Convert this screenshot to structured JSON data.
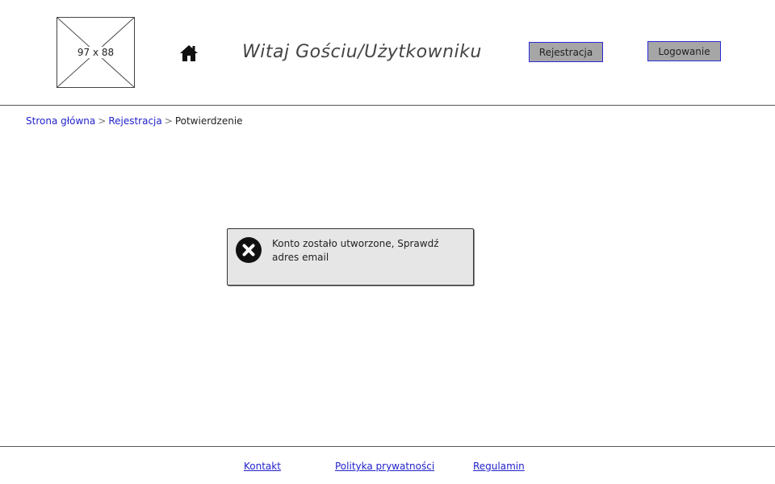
{
  "header": {
    "logo_placeholder_text": "97 x 88",
    "home_icon": "home-icon",
    "welcome_text": "Witaj Gościu/Użytkowniku",
    "register_label": "Rejestracja",
    "login_label": "Logowanie"
  },
  "breadcrumb": {
    "home": "Strona główna",
    "register": "Rejestracja",
    "current": "Potwierdzenie",
    "separator": ">"
  },
  "notification": {
    "icon": "close-circle-icon",
    "text": "Konto zostało utworzone, Sprawdź adres email"
  },
  "footer": {
    "contact": "Kontakt",
    "privacy": "Polityka prywatności",
    "terms": "Regulamin"
  },
  "colors": {
    "button_bg": "#a6a6a6",
    "button_border": "#2b2bd9",
    "link": "#2222cc",
    "notice_bg": "#e6e6e6"
  }
}
